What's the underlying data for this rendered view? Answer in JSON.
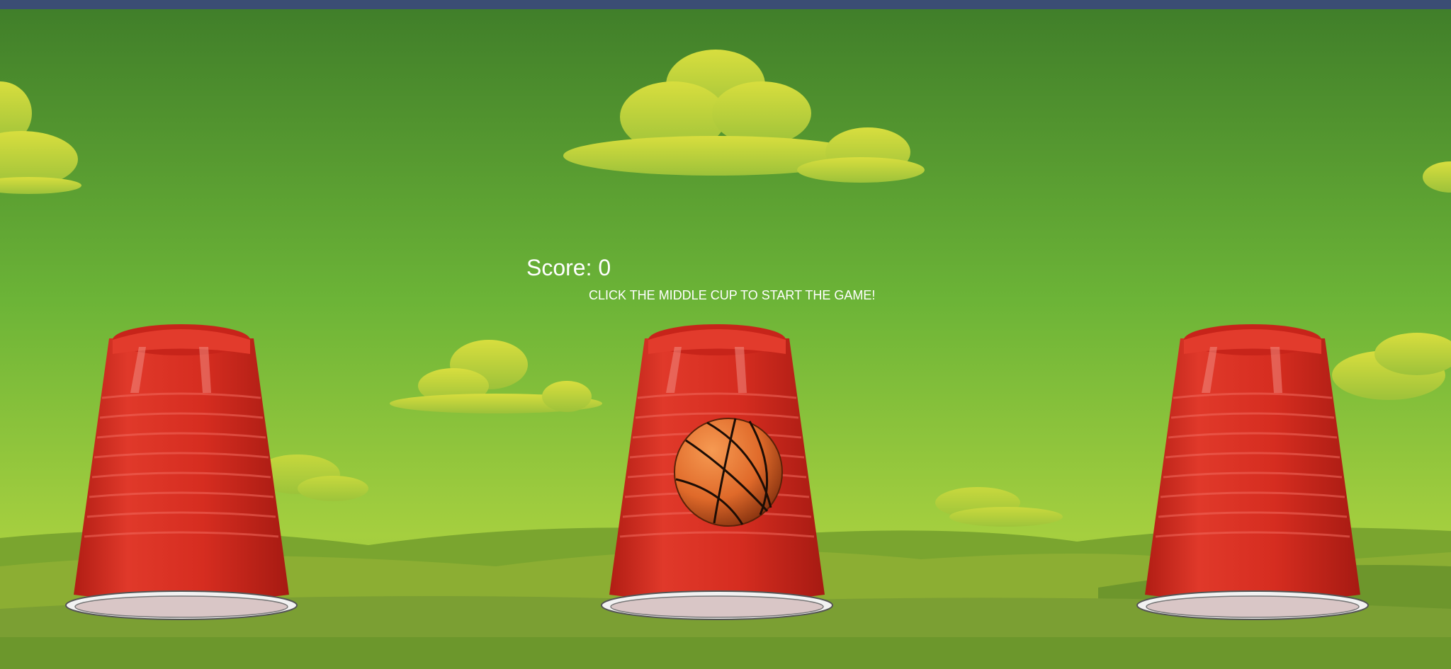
{
  "game": {
    "score_label": "Score: 0",
    "instructions": "CLICK THE MIDDLE CUP TO START THE GAME!"
  },
  "cups": [
    {
      "name": "left-cup",
      "has_ball": false
    },
    {
      "name": "middle-cup",
      "has_ball": true
    },
    {
      "name": "right-cup",
      "has_ball": false
    }
  ],
  "colors": {
    "top_bar": "#3b4d74",
    "sky_top": "#3f7d29",
    "sky_bottom": "#a5cf3f",
    "cloud": "#c8da45",
    "cup_red": "#d82f22",
    "ball_orange": "#e8762f"
  },
  "icons": {
    "ball": "basketball-icon"
  }
}
